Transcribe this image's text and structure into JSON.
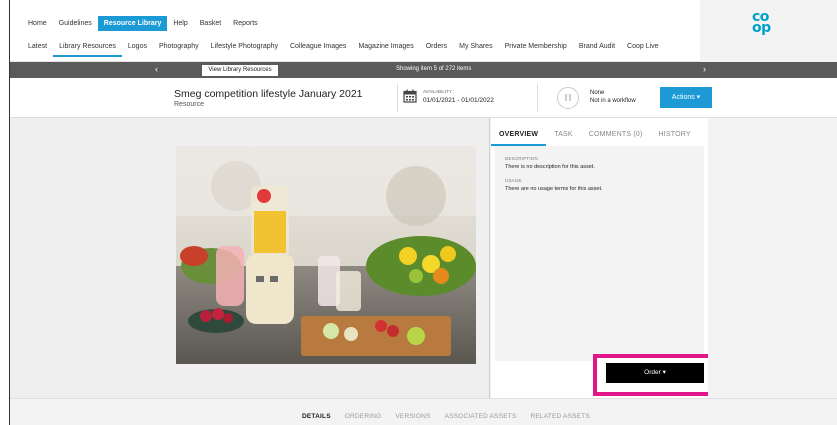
{
  "primary_nav": [
    "Home",
    "Guidelines",
    "Resource Library",
    "Help",
    "Basket",
    "Reports"
  ],
  "secondary_nav": [
    "Latest",
    "Library Resources",
    "Logos",
    "Photography",
    "Lifestyle Photography",
    "Colleague Images",
    "Magazine Images",
    "Orders",
    "My Shares",
    "Private Membership",
    "Brand Audit",
    "Coop Live"
  ],
  "logo": {
    "text_top": "co",
    "text_bottom": "op",
    "color": "#00a1cc"
  },
  "navbar": {
    "prev_icon": "‹",
    "next_icon": "›",
    "view_button": "View Library Resources",
    "showing": "Showing item 5 of 272 items"
  },
  "asset": {
    "title": "Smeg competition lifestyle January 2021",
    "type": "Resource",
    "availability_label": "AVAILABILITY :",
    "availability_dates": "01/01/2021 - 01/01/2022",
    "workflow_status": "None",
    "workflow_sub": "Not in a workflow",
    "actions_label": "Actions ▾"
  },
  "tabs": [
    "OVERVIEW",
    "TASK",
    "COMMENTS (0)",
    "HISTORY"
  ],
  "overview": {
    "description_label": "DESCRIPTION",
    "description_value": "There is no description for this asset.",
    "usage_label": "USAGE",
    "usage_value": "There are no usage terms for this asset."
  },
  "order_button": "Order ▾",
  "bottom_tabs": [
    "DETAILS",
    "ORDERING",
    "VERSIONS",
    "ASSOCIATED ASSETS",
    "RELATED ASSETS"
  ],
  "colors": {
    "accent": "#1b9ad6",
    "highlight": "#e0168a",
    "navbar": "#5a5a5a"
  }
}
